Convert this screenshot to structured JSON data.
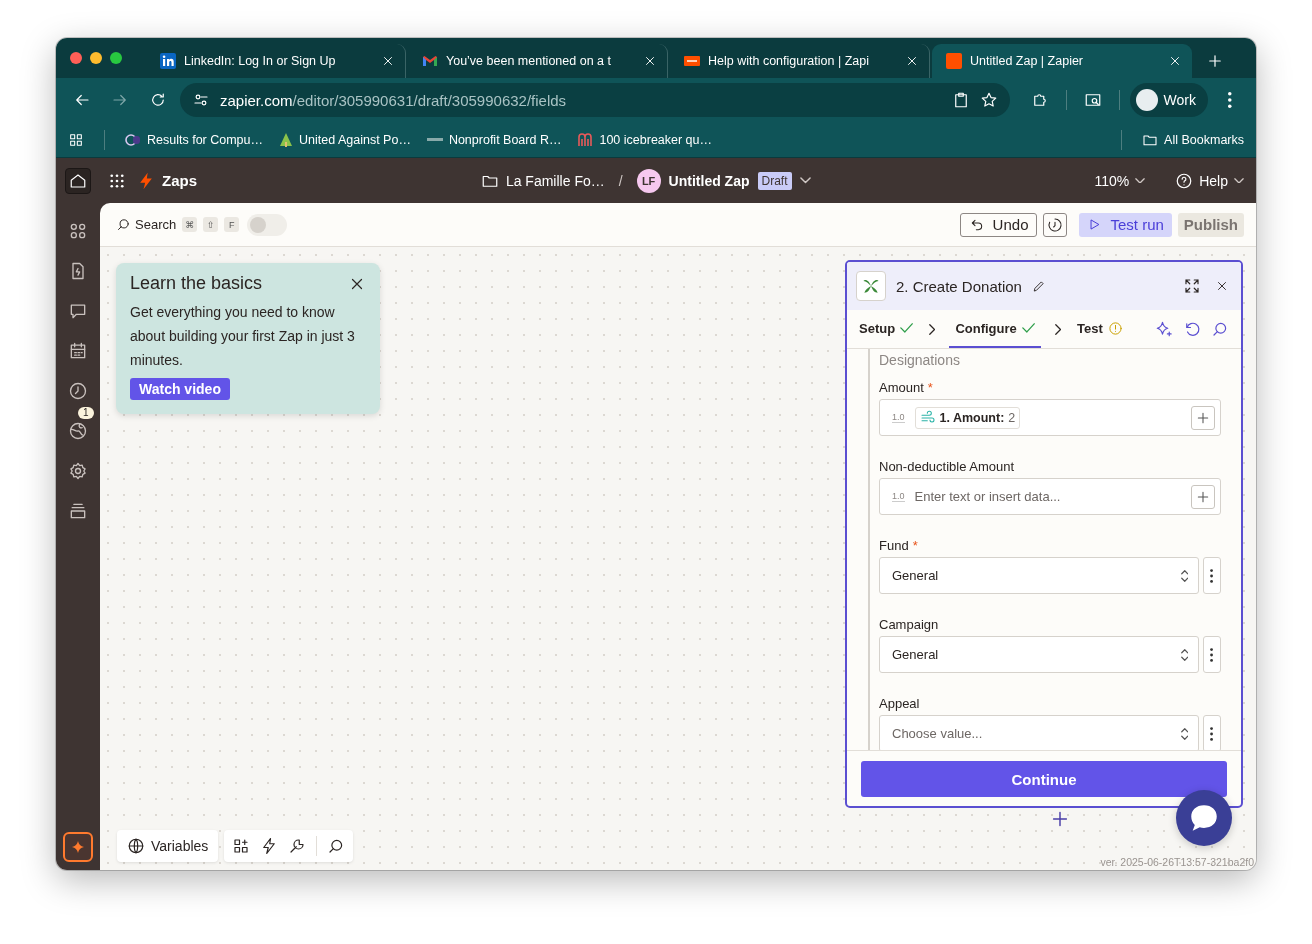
{
  "browser": {
    "tabs": [
      {
        "title": "LinkedIn: Log In or Sign Up",
        "selected": false
      },
      {
        "title": "You’ve been mentioned on a t",
        "selected": false
      },
      {
        "title": "Help with configuration | Zapi",
        "selected": false
      },
      {
        "title": "Untitled Zap | Zapier",
        "selected": true
      }
    ],
    "address": {
      "domain": "zapier.com",
      "path": "/editor/305990631/draft/305990632/fields"
    },
    "profile": "Work",
    "bookmarks": [
      {
        "label": "Results for Compu…"
      },
      {
        "label": "United Against Po…"
      },
      {
        "label": "Nonprofit Board R…"
      },
      {
        "label": "100 icebreaker qu…"
      }
    ],
    "all_bookmarks": "All Bookmarks"
  },
  "header": {
    "brand": "Zaps",
    "folder": "La Famille Fo…",
    "separator": "/",
    "avatar": "LF",
    "zap_name": "Untitled Zap",
    "status": "Draft",
    "zoom": "110%",
    "help": "Help"
  },
  "rail": {
    "badge": "1"
  },
  "toolbar": {
    "search": "Search",
    "keys": [
      "⌘",
      "⇧",
      "F"
    ],
    "toggle_on": false,
    "undo": "Undo",
    "test_run": "Test run",
    "publish": "Publish"
  },
  "tip": {
    "title": "Learn the basics",
    "body": "Get everything you need to know about building your first Zap in just 3 minutes.",
    "button": "Watch video"
  },
  "panel": {
    "title": "2. Create Donation",
    "steps": [
      {
        "label": "Setup",
        "complete": true,
        "selected": false
      },
      {
        "label": "Configure",
        "complete": true,
        "selected": true
      },
      {
        "label": "Test",
        "complete": false,
        "selected": false
      }
    ],
    "section": "Designations",
    "fields": [
      {
        "kind": "text",
        "label": "Amount",
        "required_mark": "*",
        "type_tag": "1.0",
        "chip": {
          "label": "1. Amount:",
          "value": "2"
        }
      },
      {
        "kind": "text",
        "label": "Non-deductible Amount",
        "type_tag": "1.0",
        "placeholder": "Enter text or insert data..."
      },
      {
        "kind": "select",
        "label": "Fund",
        "required_mark": "*",
        "value": "General"
      },
      {
        "kind": "select",
        "label": "Campaign",
        "value": "General"
      },
      {
        "kind": "select",
        "label": "Appeal",
        "placeholder": "Choose value..."
      }
    ],
    "continue": "Continue"
  },
  "canvas": {
    "variables": "Variables",
    "version": "ver. 2025-06-26T13:57-321ba2f0"
  }
}
